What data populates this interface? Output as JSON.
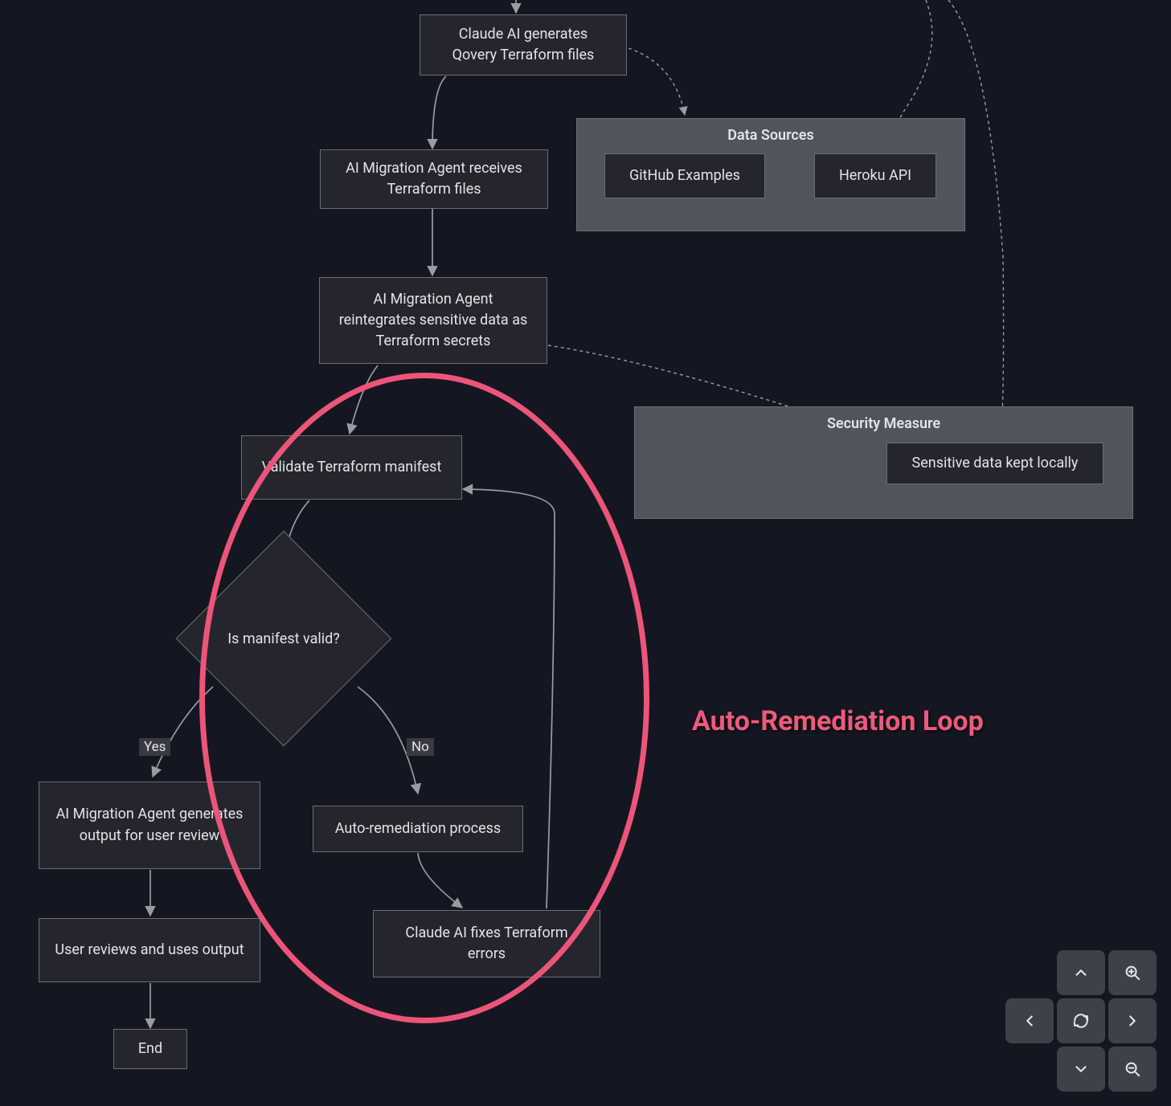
{
  "nodes": {
    "generates_tf": "Claude AI generates Qovery Terraform files",
    "receives_tf": "AI Migration Agent receives Terraform files",
    "reintegrates": "AI Migration Agent reintegrates sensitive data as Terraform secrets",
    "validate": "Validate Terraform manifest",
    "decision": "Is manifest valid?",
    "gen_output": "AI Migration Agent generates output for user review",
    "auto_remediation": "Auto-remediation process",
    "user_reviews": "User reviews and uses output",
    "fixes": "Claude AI fixes Terraform errors",
    "end": "End",
    "github_examples": "GitHub Examples",
    "heroku_api": "Heroku API",
    "sensitive_local": "Sensitive data kept locally"
  },
  "groups": {
    "data_sources": "Data Sources",
    "security": "Security Measure"
  },
  "edge_labels": {
    "yes": "Yes",
    "no": "No"
  },
  "annotation": "Auto-Remediation Loop",
  "controls": {
    "up": "pan-up",
    "down": "pan-down",
    "left": "pan-left",
    "right": "pan-right",
    "reset": "reset-view",
    "zoom_in": "zoom-in",
    "zoom_out": "zoom-out"
  }
}
